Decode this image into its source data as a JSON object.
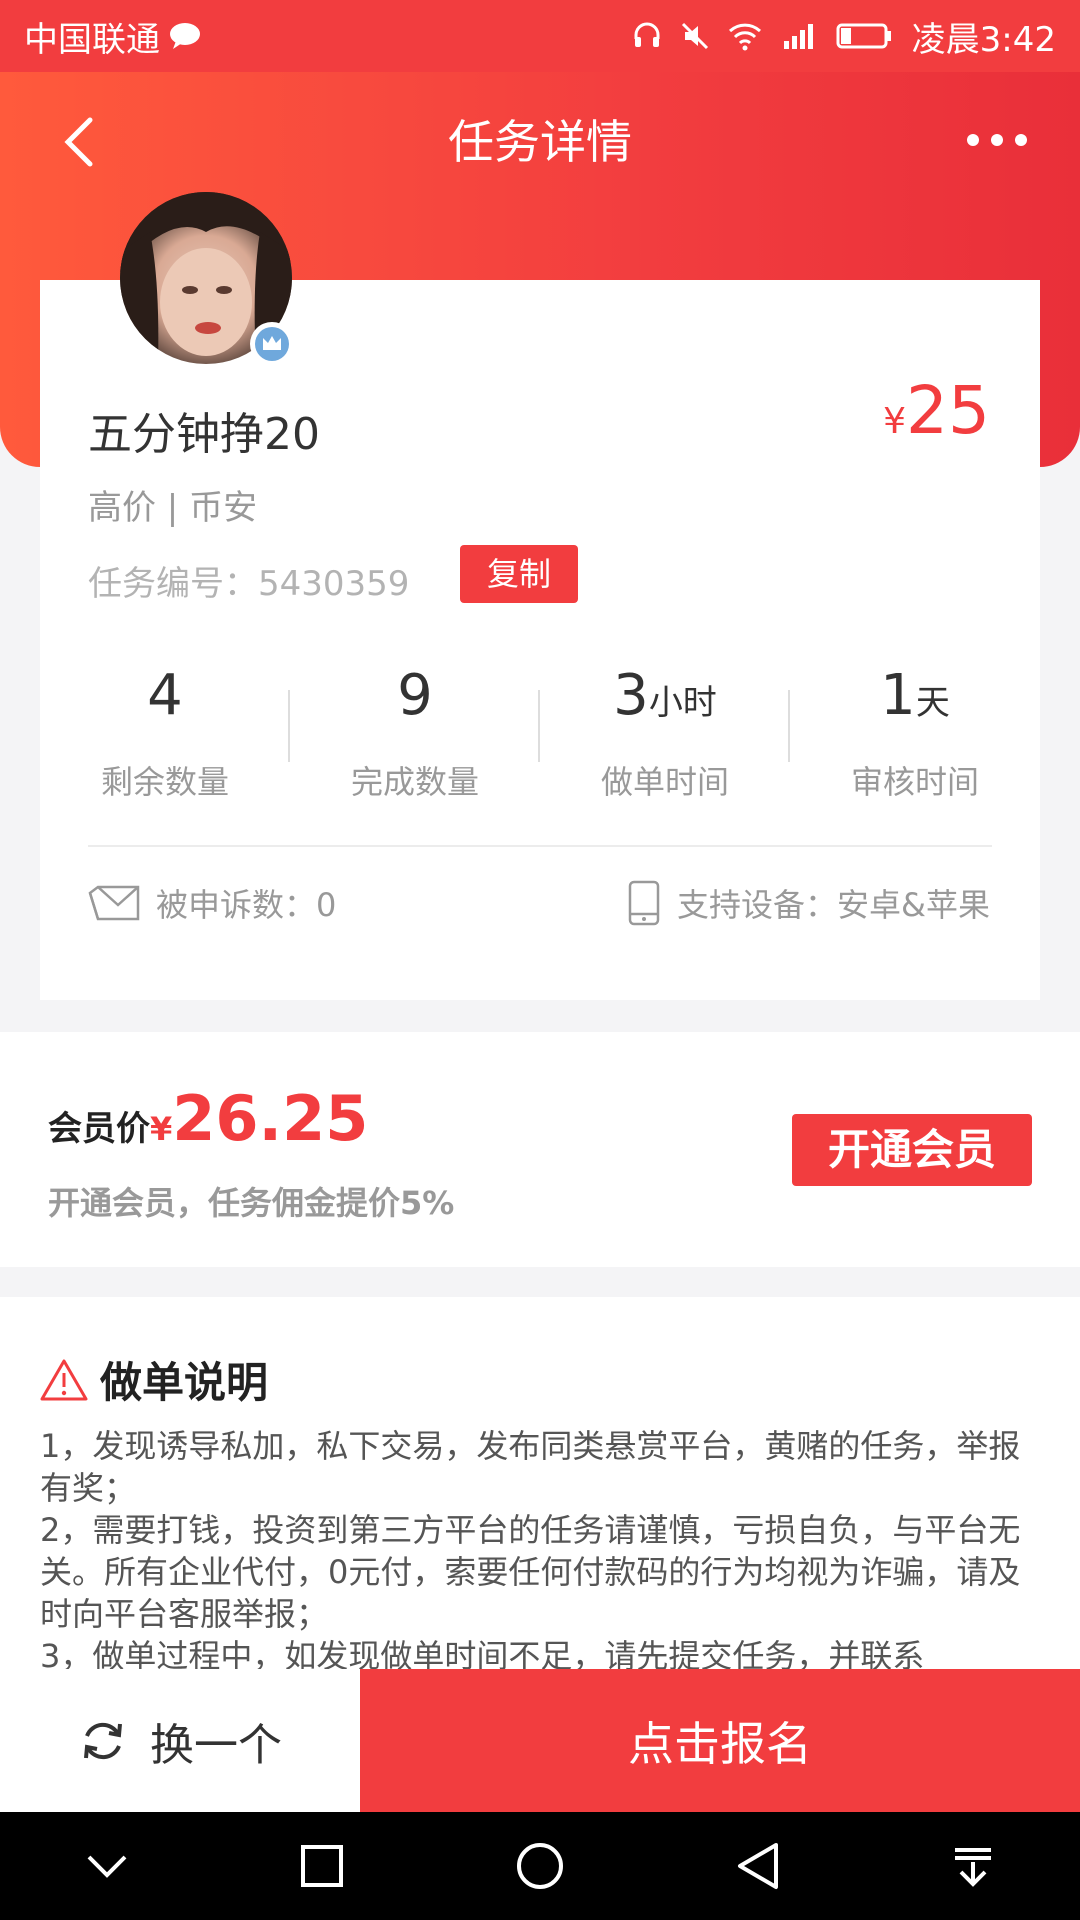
{
  "status_bar": {
    "carrier": "中国联通",
    "time": "凌晨3:42"
  },
  "header": {
    "title": "任务详情"
  },
  "task": {
    "title": "五分钟挣20",
    "price_currency": "¥",
    "price": "25",
    "tags": "高价 | 币安",
    "number_label": "任务编号：",
    "number": "5430359",
    "copy_label": "复制"
  },
  "stats": [
    {
      "value": "4",
      "unit": "",
      "label": "剩余数量"
    },
    {
      "value": "9",
      "unit": "",
      "label": "完成数量"
    },
    {
      "value": "3",
      "unit": "小时",
      "label": "做单时间"
    },
    {
      "value": "1",
      "unit": "天",
      "label": "审核时间"
    }
  ],
  "meta": {
    "complaints": "被申诉数：0",
    "devices": "支持设备：安卓&苹果"
  },
  "vip": {
    "label": "会员价",
    "currency": "¥",
    "price": "26.25",
    "subtitle": "开通会员，任务佣金提价5%",
    "button": "开通会员"
  },
  "notes": {
    "title": "做单说明",
    "text": "1，发现诱导私加，私下交易，发布同类悬赏平台，黄赌的任务，举报有奖；\n2，需要打钱，投资到第三方平台的任务请谨慎，亏损自负，与平台无关。所有企业代付，0元付，索要任何付款码的行为均视为诈骗，请及时向平台客服举报；\n3，做单过程中，如发现做单时间不足，请先提交任务，并联系"
  },
  "footer": {
    "swap": "换一个",
    "signup": "点击报名"
  },
  "icons": {
    "back": "chevron-left-icon",
    "more": "more-icon",
    "refresh": "refresh-icon",
    "warning": "warning-icon",
    "complaint": "envelope-icon",
    "device": "phone-icon"
  },
  "colors": {
    "accent": "#f23d3f",
    "gradient_start": "#ff5a3c"
  }
}
